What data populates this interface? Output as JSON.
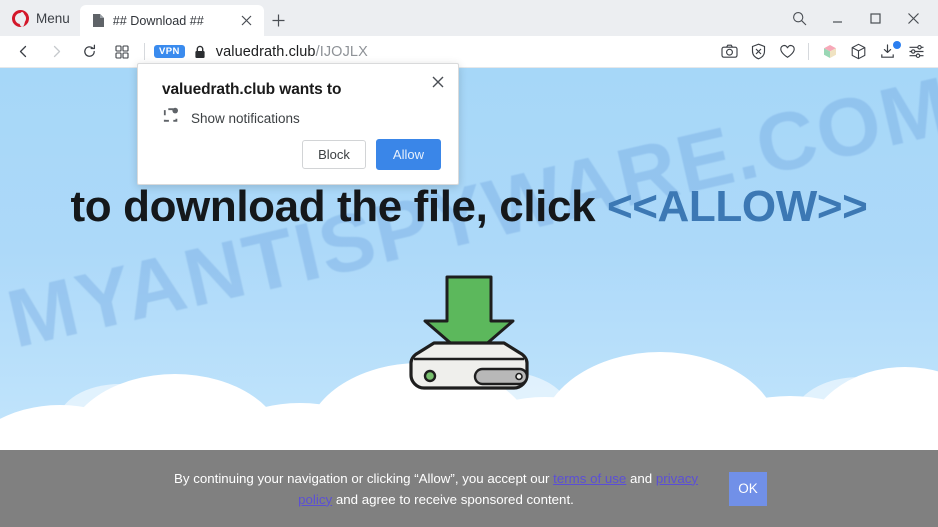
{
  "browser": {
    "menu_label": "Menu",
    "tab": {
      "title": "## Download ##",
      "favicon_icon": "page-icon",
      "close_icon": "close-icon"
    },
    "new_tab_icon": "plus-icon",
    "window_controls": {
      "search_icon": "search-icon",
      "minimize_icon": "minimize-icon",
      "maximize_icon": "maximize-icon",
      "close_icon": "close-icon"
    },
    "nav": {
      "back_icon": "back-arrow-icon",
      "forward_icon": "forward-arrow-icon",
      "reload_icon": "reload-icon",
      "speeddial_icon": "grid-icon",
      "vpn_badge": "VPN",
      "lock_icon": "padlock-icon",
      "url_domain": "valuedrath.club",
      "url_path": "/IJOJLX"
    },
    "nav_right": {
      "snapshot_icon": "camera-icon",
      "adblock_icon": "shield-block-icon",
      "heart_icon": "heart-icon",
      "extensions_icon": "colored-cube-icon",
      "workspaces_icon": "cube-icon",
      "downloads_icon": "download-tray-icon",
      "downloads_badge": true,
      "easysetup_icon": "sliders-icon"
    }
  },
  "dialog": {
    "title": "valuedrath.club wants to",
    "permission_icon": "notification-bell-icon",
    "permission_label": "Show notifications",
    "close_icon": "close-icon",
    "block_label": "Block",
    "allow_label": "Allow"
  },
  "page": {
    "watermark": "MYANTISPYWARE.COM",
    "headline_prefix": "to download the file, click ",
    "headline_allow": "<<ALLOW>>",
    "illustration_icon": "download-to-drive-icon"
  },
  "cookiebar": {
    "text_part1": "By continuing your navigation or clicking “Allow”, you accept our ",
    "link_terms": "terms of use",
    "text_part2": " and ",
    "link_privacy": "privacy policy",
    "text_part3": " and agree to receive sponsored content.",
    "ok_label": "OK"
  },
  "colors": {
    "sky": "#a8d8f8",
    "allow_button": "#3a86e8",
    "accent_link": "#5b4fd6",
    "cookiebar_bg": "#808080",
    "ok_button": "#7190e8",
    "opera_red": "#d3172a",
    "vpn_blue": "#3a8bee",
    "arrow_green": "#5cb85c",
    "headline_allow": "#3c78b4"
  }
}
